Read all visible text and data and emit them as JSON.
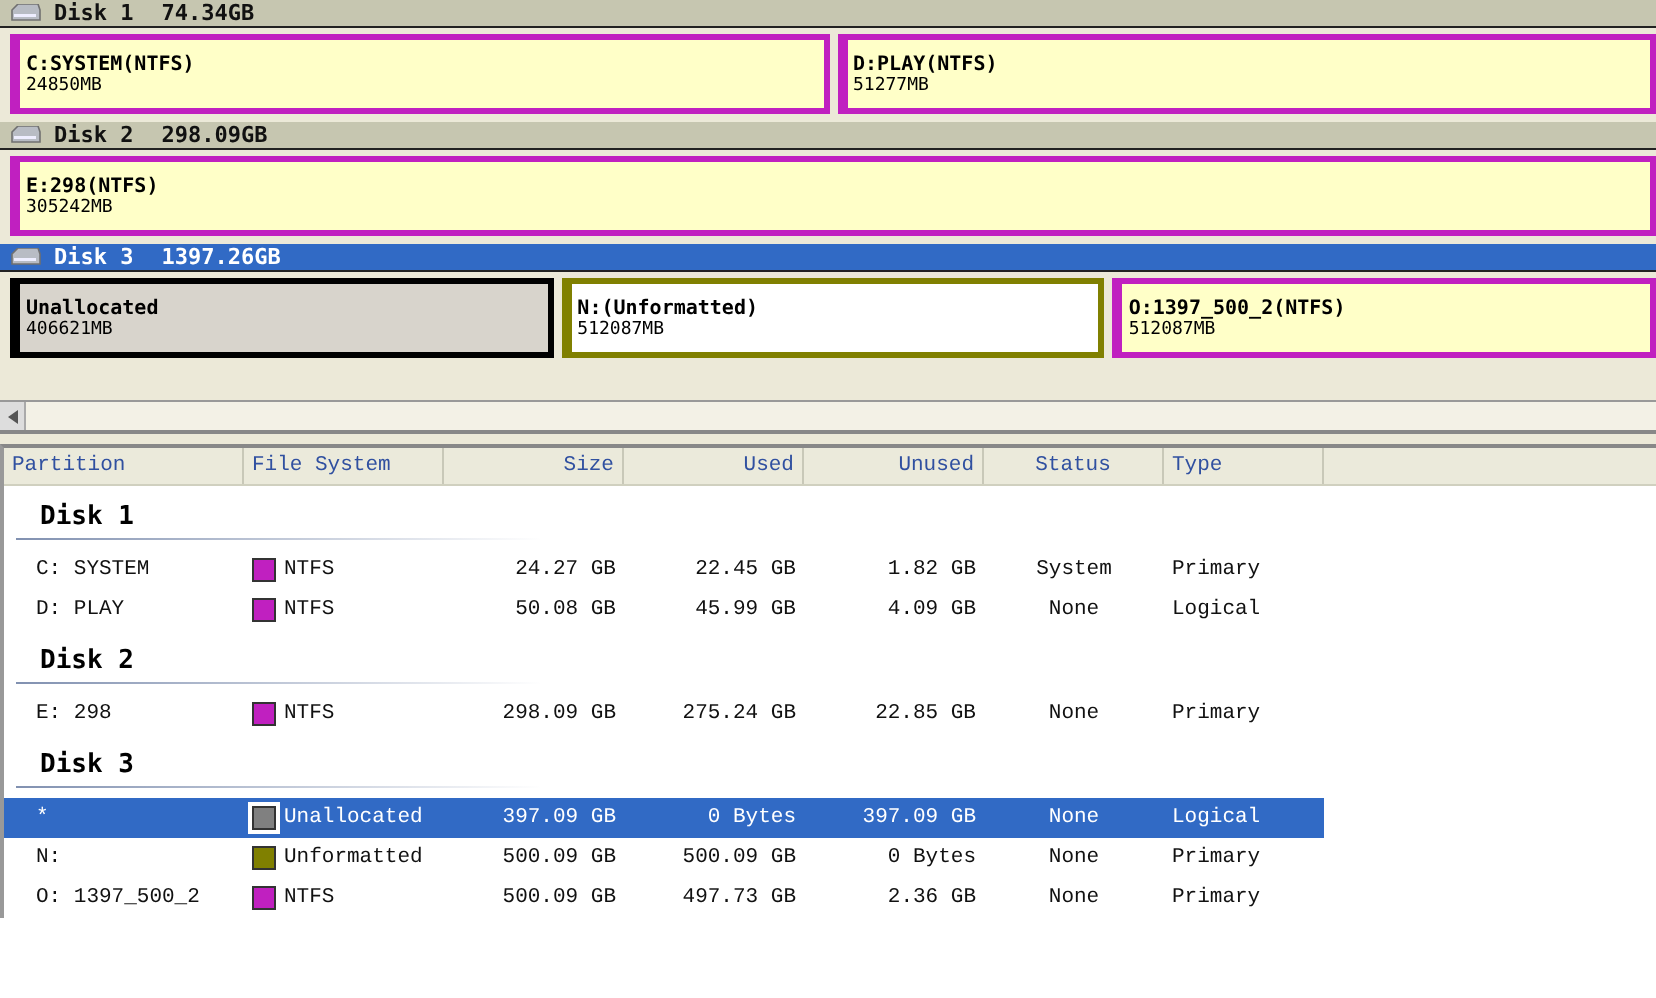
{
  "disks": [
    {
      "label": "Disk 1",
      "capacity": "74.34GB",
      "selected": false,
      "partitions": [
        {
          "name": "C:SYSTEM(NTFS)",
          "size": "24850MB",
          "color": "#c020c0"
        },
        {
          "name": "D:PLAY(NTFS)",
          "size": "51277MB",
          "color": "#c020c0"
        }
      ]
    },
    {
      "label": "Disk 2",
      "capacity": "298.09GB",
      "selected": false,
      "partitions": [
        {
          "name": "E:298(NTFS)",
          "size": "305242MB",
          "color": "#c020c0"
        }
      ]
    },
    {
      "label": "Disk 3",
      "capacity": "1397.26GB",
      "selected": true,
      "partitions": [
        {
          "name": "Unallocated",
          "size": "406621MB",
          "color": "#000000"
        },
        {
          "name": "N:(Unformatted)",
          "size": "512087MB",
          "color": "#808000"
        },
        {
          "name": "O:1397_500_2(NTFS)",
          "size": "512087MB",
          "color": "#c020c0"
        }
      ]
    }
  ],
  "table": {
    "columns": [
      "Partition",
      "File System",
      "Size",
      "Used",
      "Unused",
      "Status",
      "Type"
    ],
    "groups": [
      {
        "label": "Disk 1",
        "rows": [
          {
            "partition": "C: SYSTEM",
            "file_system": "NTFS",
            "color": "#c020c0",
            "size": "24.27 GB",
            "used": "22.45 GB",
            "unused": "1.82 GB",
            "status": "System",
            "type": "Primary",
            "selected": false
          },
          {
            "partition": "D: PLAY",
            "file_system": "NTFS",
            "color": "#c020c0",
            "size": "50.08 GB",
            "used": "45.99 GB",
            "unused": "4.09 GB",
            "status": "None",
            "type": "Logical",
            "selected": false
          }
        ]
      },
      {
        "label": "Disk 2",
        "rows": [
          {
            "partition": "E: 298",
            "file_system": "NTFS",
            "color": "#c020c0",
            "size": "298.09 GB",
            "used": "275.24 GB",
            "unused": "22.85 GB",
            "status": "None",
            "type": "Primary",
            "selected": false
          }
        ]
      },
      {
        "label": "Disk 3",
        "rows": [
          {
            "partition": "*",
            "file_system": "Unallocated",
            "color": "#808080",
            "size": "397.09 GB",
            "used": "0 Bytes",
            "unused": "397.09 GB",
            "status": "None",
            "type": "Logical",
            "selected": true
          },
          {
            "partition": "N:",
            "file_system": "Unformatted",
            "color": "#808000",
            "size": "500.09 GB",
            "used": "500.09 GB",
            "unused": "0 Bytes",
            "status": "None",
            "type": "Primary",
            "selected": false
          },
          {
            "partition": "O: 1397_500_2",
            "file_system": "NTFS",
            "color": "#c020c0",
            "size": "500.09 GB",
            "used": "497.73 GB",
            "unused": "2.36 GB",
            "status": "None",
            "type": "Primary",
            "selected": false
          }
        ]
      }
    ]
  }
}
